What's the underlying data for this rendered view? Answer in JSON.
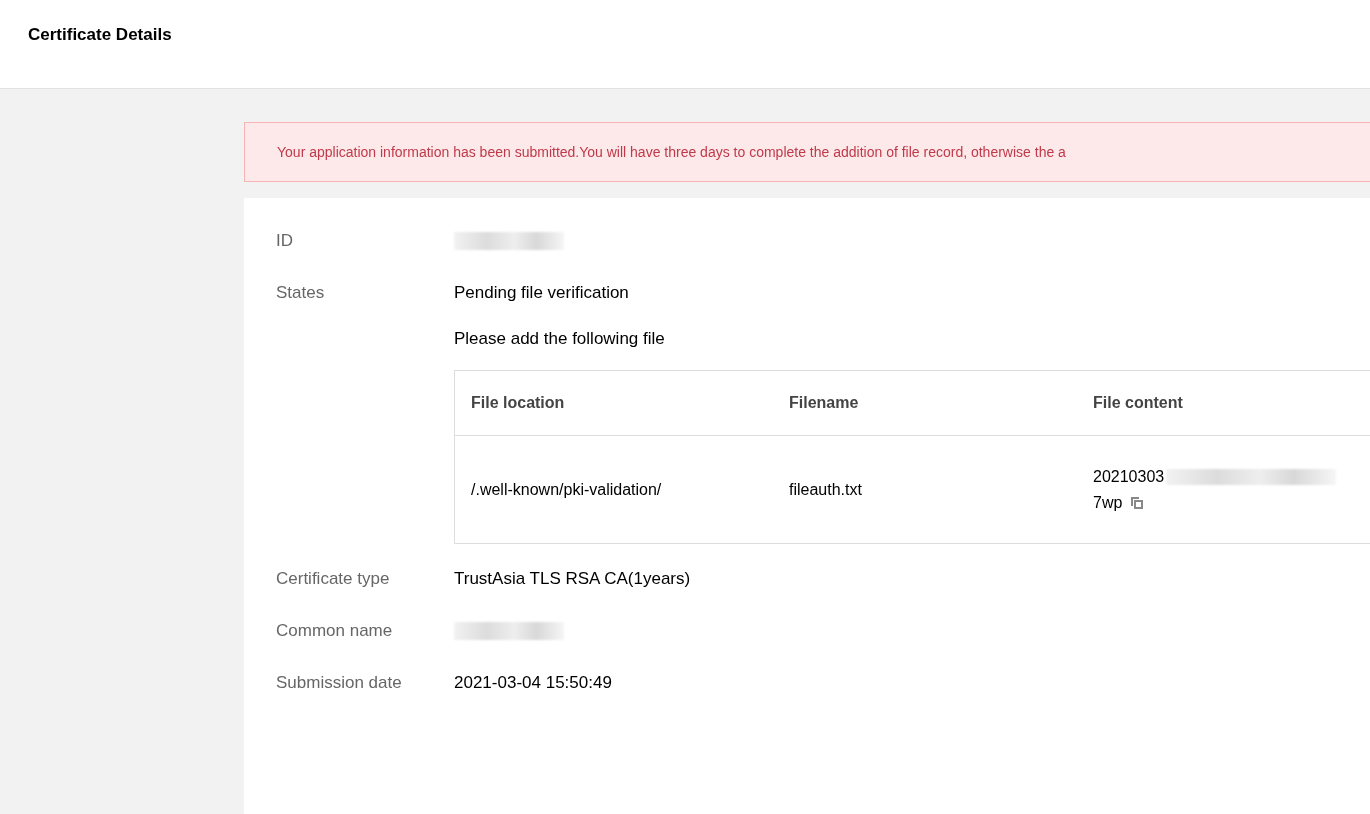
{
  "header": {
    "title": "Certificate Details"
  },
  "alert": {
    "text": "Your application information has been submitted.You will have three days to complete the addition of file record, otherwise the a"
  },
  "details": [
    {
      "kind": "redacted",
      "label": "ID"
    },
    {
      "kind": "status",
      "label": "States",
      "status": "Pending file verification",
      "instruction": "Please add the following file",
      "table": {
        "columns": [
          "File location",
          "Filename",
          "File content"
        ],
        "rows": [
          {
            "cells": [
              "/.well-known/pki-validation/",
              "fileauth.txt"
            ],
            "content_start": "20210303",
            "content_end": "7wp"
          }
        ]
      }
    },
    {
      "kind": "text",
      "label": "Certificate type",
      "value": "TrustAsia TLS RSA CA(1years)"
    },
    {
      "kind": "redacted",
      "label": "Common name"
    },
    {
      "kind": "text",
      "label": "Submission date",
      "value": "2021-03-04 15:50:49"
    }
  ]
}
